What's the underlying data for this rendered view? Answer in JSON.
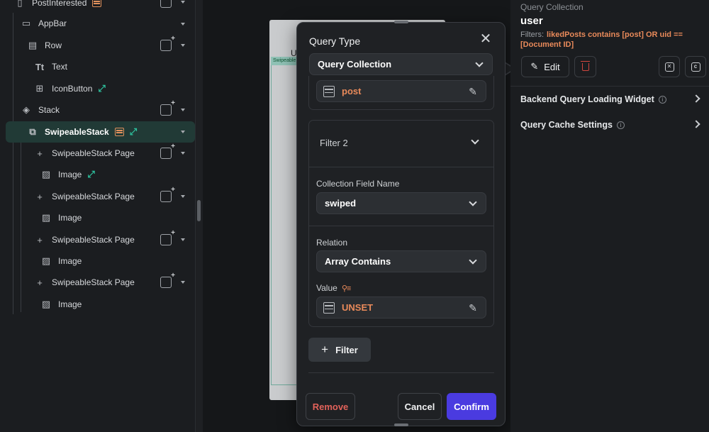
{
  "tree": {
    "items": [
      {
        "label": "PostInterested",
        "icon": "page-icon"
      },
      {
        "label": "AppBar",
        "icon": "appbar-icon"
      },
      {
        "label": "Row",
        "icon": "row-icon"
      },
      {
        "label": "Text",
        "icon": "text-icon"
      },
      {
        "label": "IconButton",
        "icon": "icon-button-icon"
      },
      {
        "label": "Stack",
        "icon": "stack-icon"
      },
      {
        "label": "SwipeableStack",
        "icon": "swipeable-stack-icon"
      },
      {
        "label": "SwipeableStack Page",
        "icon": "plus-icon"
      },
      {
        "label": "Image",
        "icon": "image-icon"
      },
      {
        "label": "SwipeableStack Page",
        "icon": "plus-icon"
      },
      {
        "label": "Image",
        "icon": "image-icon"
      },
      {
        "label": "SwipeableStack Page",
        "icon": "plus-icon"
      },
      {
        "label": "Image",
        "icon": "image-icon"
      },
      {
        "label": "SwipeableStack Page",
        "icon": "plus-icon"
      },
      {
        "label": "Image",
        "icon": "image-icon"
      }
    ]
  },
  "canvas": {
    "phone_letter": "U",
    "swipe_tag": "Swipeable"
  },
  "modal": {
    "title": "Query Type",
    "query_type_value": "Query Collection",
    "collection_value": "post",
    "filter2_title": "Filter 2",
    "field_name_label": "Collection Field Name",
    "field_name_value": "swiped",
    "relation_label": "Relation",
    "relation_value": "Array Contains",
    "value_label": "Value",
    "value_value": "UNSET",
    "add_filter_label": "Filter",
    "remove_label": "Remove",
    "cancel_label": "Cancel",
    "confirm_label": "Confirm"
  },
  "props": {
    "type_label": "Query Collection",
    "collection": "user",
    "filters_label": "Filters:",
    "filters_text": "likedPosts contains [post] OR uid == [Document ID]",
    "edit_label": "Edit",
    "row1": "Backend Query Loading Widget",
    "row2": "Query Cache Settings"
  },
  "colors": {
    "accent": "#4a3be0",
    "warning_text": "#e98a5a",
    "danger": "#d0463e",
    "selection": "#213a36",
    "flow_icon": "#2ec4a0"
  }
}
